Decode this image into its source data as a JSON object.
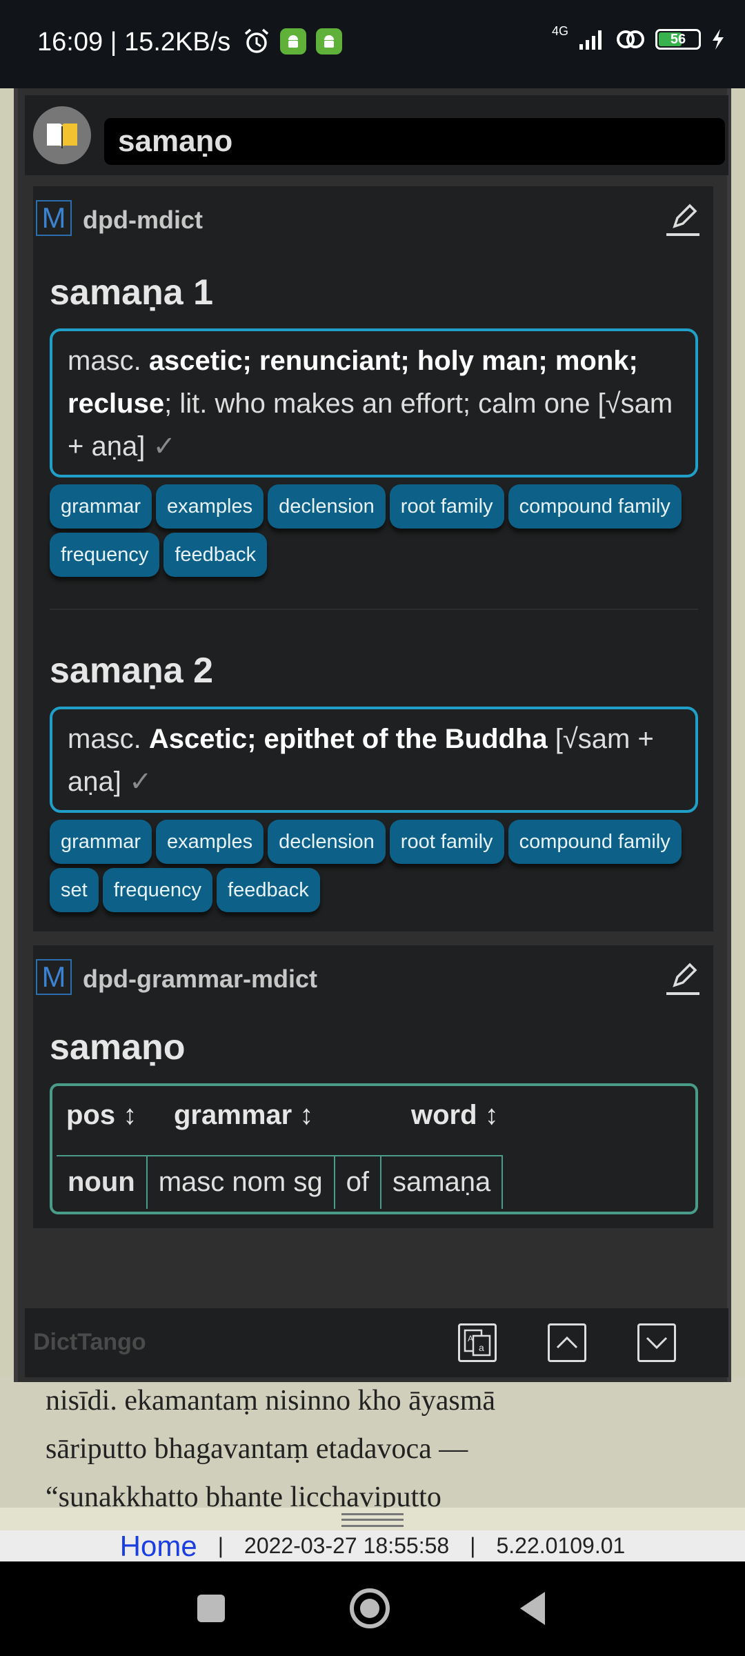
{
  "status_bar": {
    "time_speed": "16:09 | 15.2KB/s",
    "network": "4G",
    "battery": "56"
  },
  "search": {
    "value": "samaṇo"
  },
  "dict1": {
    "name": "dpd-mdict",
    "badge": "M",
    "entry1": {
      "headword": "samaṇa 1",
      "pos": "masc.",
      "meaning_bold": "ascetic; renunciant; holy man; monk; recluse",
      "meaning_rest": "; lit. who makes an effort; calm one [√sam + aṇa]",
      "check": "✓",
      "buttons": [
        "grammar",
        "examples",
        "declension",
        "root family",
        "compound family",
        "frequency",
        "feedback"
      ]
    },
    "entry2": {
      "headword": "samaṇa 2",
      "pos": "masc.",
      "meaning_bold": "Ascetic; epithet of the Buddha",
      "meaning_rest": " [√sam + aṇa]",
      "check": "✓",
      "buttons": [
        "grammar",
        "examples",
        "declension",
        "root family",
        "compound family",
        "set",
        "frequency",
        "feedback"
      ]
    }
  },
  "dict2": {
    "name": "dpd-grammar-mdict",
    "badge": "M",
    "headword": "samaṇo",
    "table": {
      "headers": [
        "pos ↕",
        "grammar ↕",
        "word ↕"
      ],
      "row": [
        "noun",
        "masc nom sg",
        "of",
        "samaṇa"
      ]
    }
  },
  "bottom_bar": {
    "brand": "DictTango"
  },
  "reading": {
    "line1": "nisīdi. ekamantaṃ nisinno kho āyasmā",
    "line2": "sāriputto bhagavantaṃ etadavoca —",
    "line3": "“sunakkhatto bhante licchaviputto"
  },
  "footer": {
    "home": "Home",
    "sep": "|",
    "datetime": "2022-03-27 18:55:58",
    "version": "5.22.0109.01"
  }
}
